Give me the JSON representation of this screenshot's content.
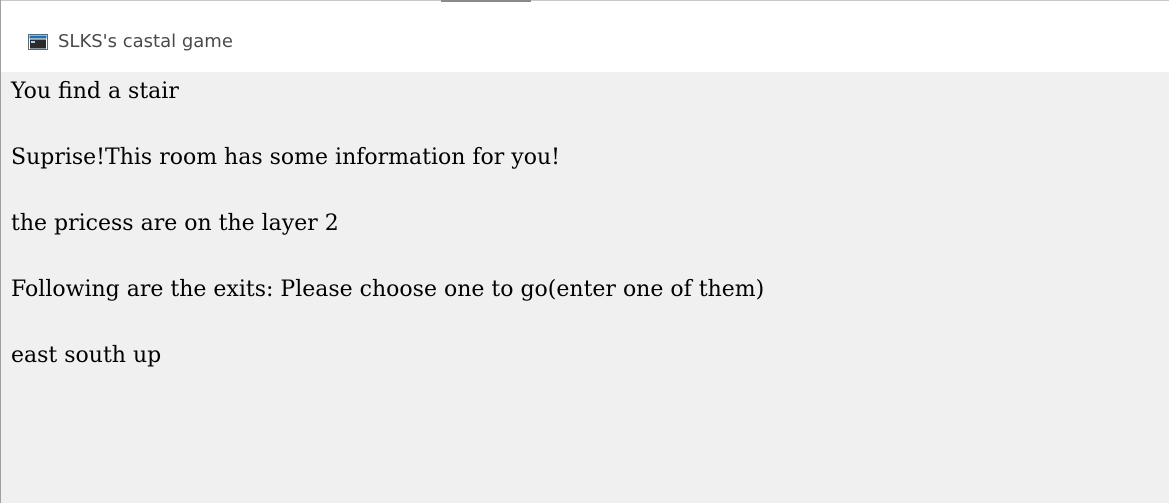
{
  "window": {
    "title": "SLKS's castal game",
    "icon": "console-window-icon"
  },
  "console": {
    "lines": [
      "You find a stair",
      "Suprise!This room has some information for you!",
      "the pricess are on the layer 2",
      "Following are the exits: Please choose one to go(enter one of them)",
      "east south up"
    ]
  },
  "colors": {
    "titlebar_bg": "#ffffff",
    "client_bg": "#f0f0f0",
    "text": "#000000",
    "title_text": "#4a4a4a"
  }
}
